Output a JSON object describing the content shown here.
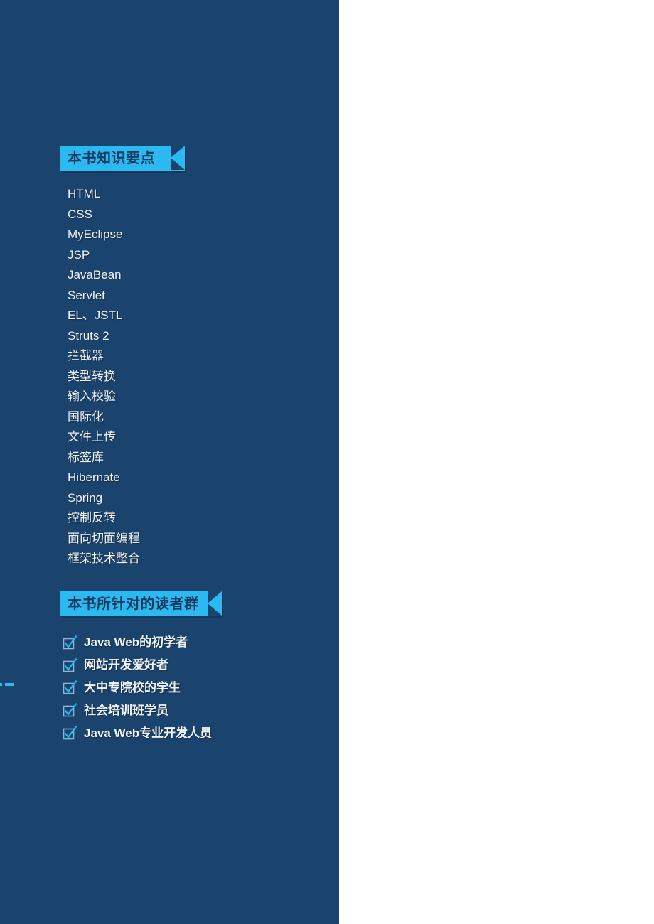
{
  "panel": {
    "background_color": "#1a436d",
    "page_background_color": "#ffffff",
    "accent_color": "#2ab9f0",
    "text_color": "#f2f5f8",
    "ribbon_text_color": "#133a5e"
  },
  "sections": [
    {
      "id": "knowledge",
      "ribbon_label": "本书知识要点",
      "items": [
        "HTML",
        "CSS",
        "MyEclipse",
        "JSP",
        "JavaBean",
        "Servlet",
        "EL、JSTL",
        "Struts 2",
        "拦截器",
        "类型转换",
        "输入校验",
        "国际化",
        "文件上传",
        "标签库",
        "Hibernate",
        "Spring",
        "控制反转",
        "面向切面编程",
        "框架技术整合"
      ]
    },
    {
      "id": "readers",
      "ribbon_label": "本书所针对的读者群",
      "items": [
        "Java Web的初学者",
        "网站开发爱好者",
        "大中专院校的学生",
        "社会培训班学员",
        "Java Web专业开发人员"
      ]
    }
  ],
  "icons": {
    "checkbox": "checked-checkbox-icon"
  },
  "edge_marks": [
    {
      "id": "edge-mark-a"
    },
    {
      "id": "edge-mark-b"
    }
  ]
}
